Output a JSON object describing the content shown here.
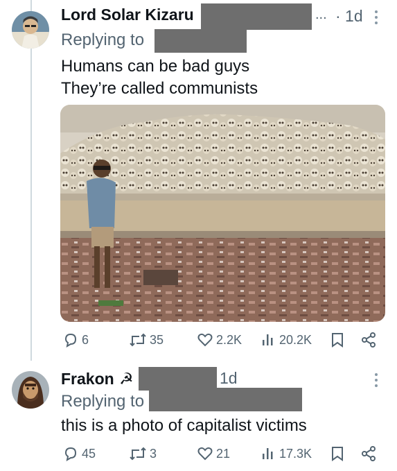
{
  "tweets": [
    {
      "author": "Lord Solar Kizaru",
      "ellipsis": "...",
      "time": "· 1d",
      "replying_to": "Replying to",
      "text_lines": [
        "Humans can be bad guys",
        "They’re called communists"
      ],
      "stats": {
        "replies": "6",
        "reposts": "35",
        "likes": "2.2K",
        "views": "20.2K"
      }
    },
    {
      "author": "Frakon",
      "flag": "☭",
      "time": "1d",
      "replying_to": "Replying to",
      "text_lines": [
        "this is a photo of capitalist victims"
      ],
      "stats": {
        "replies": "45",
        "reposts": "3",
        "likes": "21",
        "views": "17.3K"
      }
    }
  ],
  "icons": {
    "more": "more-options-icon",
    "reply": "reply-icon",
    "repost": "repost-icon",
    "like": "like-icon",
    "views": "views-icon",
    "bookmark": "bookmark-icon",
    "share": "share-icon"
  },
  "colors": {
    "text": "#0f1419",
    "muted": "#536471",
    "redaction": "#6e6e6e",
    "thread_line": "#cfd9de"
  }
}
